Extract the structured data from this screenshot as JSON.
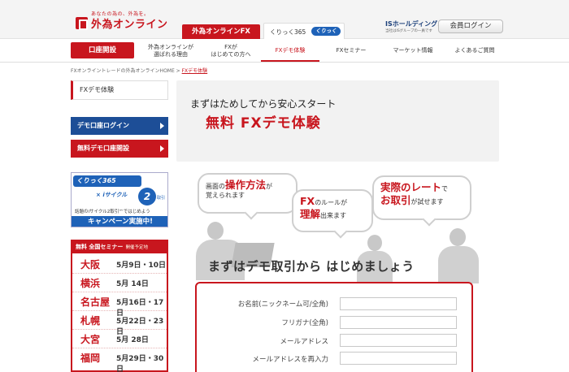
{
  "header": {
    "logo_tagline": "あなたの為の、外為を。",
    "logo_name": "外為オンライン",
    "tab_gaitame": "外為オンラインFX",
    "tab_kurikku": "くりっく365",
    "tab_kurikku_badge": "くりっく365",
    "holdings_name": "ISホールディングス",
    "holdings_sub": "当社はISグループの一員です",
    "login_button": "会員ログイン"
  },
  "nav": {
    "account_open": "口座開設",
    "items": [
      {
        "label": "外為オンラインが\n選ばれる理由"
      },
      {
        "label": "FXが\nはじめての方へ"
      },
      {
        "label": "FXデモ体験"
      },
      {
        "label": "FXセミナー"
      },
      {
        "label": "マーケット情報"
      },
      {
        "label": "よくあるご質問"
      }
    ],
    "active_index": 2
  },
  "breadcrumb": {
    "home": "FXオンライントレードの外為オンラインHOME",
    "separator": " > ",
    "current": "FXデモ体験"
  },
  "sidebar": {
    "title": "FXデモ体験",
    "demo_login": "デモ口座ログイン",
    "demo_open": "無料デモ口座開設",
    "banner": {
      "badge": "くりっく365",
      "cross": "×",
      "icycle": "iサイクル",
      "num": "2",
      "torihiki": "取引",
      "line": "話題のiサイクル2取引™ではじめよう",
      "campaign": "キャンペーン実施中!"
    },
    "seminar": {
      "header": "無料 全国セミナー",
      "header_sub": "開催予定地",
      "rows": [
        {
          "city": "大阪",
          "dates": "5月9日・10日"
        },
        {
          "city": "横浜",
          "dates": "5月 14日"
        },
        {
          "city": "名古屋",
          "dates": "5月16日・17日"
        },
        {
          "city": "札幌",
          "dates": "5月22日・23日"
        },
        {
          "city": "大宮",
          "dates": "5月 28日"
        },
        {
          "city": "福岡",
          "dates": "5月29日・30日"
        }
      ]
    }
  },
  "main": {
    "hero_subtitle": "まずはためしてから安心スタート",
    "hero_title": "無料 FXデモ体験",
    "bubbles": [
      {
        "pre": "画面の",
        "big": "操作方法",
        "post": "が",
        "line2": "覚えられます"
      },
      {
        "pre": "",
        "big": "FX",
        "post": "のルールが",
        "line2": "理解",
        "line2_post": "出来ます"
      },
      {
        "pre": "",
        "big": "実際のレート",
        "post": "で",
        "line2": "お取引",
        "line2_post": "が試せます"
      }
    ],
    "start_text": "まずはデモ取引から はじめましょう"
  },
  "form": {
    "fields": [
      {
        "label": "お名前(ニックネーム可/全角)",
        "value": ""
      },
      {
        "label": "フリガナ(全角)",
        "value": ""
      },
      {
        "label": "メールアドレス",
        "value": ""
      },
      {
        "label": "メールアドレスを再入力",
        "value": ""
      }
    ]
  },
  "colors": {
    "brand_red": "#c8161e",
    "demo_blue": "#1d4e97",
    "kurikku_blue": "#1e62b8"
  }
}
